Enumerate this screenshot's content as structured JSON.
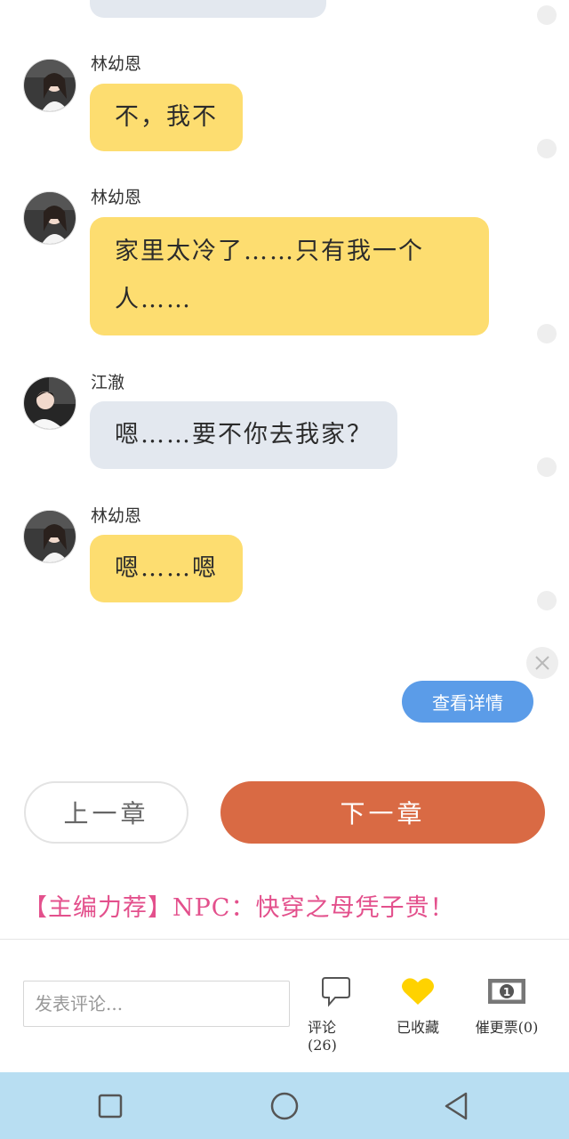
{
  "chat": {
    "messages": [
      {
        "name": "林幼恩",
        "text": "不，我不",
        "style": "yellow"
      },
      {
        "name": "林幼恩",
        "text_line1": "家里太冷了……只有我一个",
        "text_line2": "人……",
        "style": "yellow"
      },
      {
        "name": "江澈",
        "text": "嗯……要不你去我家？",
        "style": "gray"
      },
      {
        "name": "林幼恩",
        "text": "嗯……嗯",
        "style": "yellow"
      }
    ]
  },
  "ad": {
    "detail_label": "查看详情"
  },
  "chapter_nav": {
    "prev_label": "上一章",
    "next_label": "下一章"
  },
  "recommend": {
    "text": "【主编力荐】NPC：快穿之母凭子贵！"
  },
  "bottom_bar": {
    "comment_placeholder": "发表评论...",
    "comments_label": "评论(26)",
    "favorite_label": "已收藏",
    "urge_label": "催更票(0)"
  },
  "colors": {
    "yellow_bubble": "#fddd70",
    "gray_bubble": "#e3e8ef",
    "next_button": "#d96a44",
    "detail_button": "#5b9ce8",
    "recommend_text": "#e3508c",
    "navbar": "#b8def2"
  },
  "icons": {
    "comments": "speech-bubble-icon",
    "favorite": "heart-icon",
    "urge": "banknote-icon",
    "nav_recent": "square-icon",
    "nav_home": "circle-icon",
    "nav_back": "triangle-back-icon"
  }
}
